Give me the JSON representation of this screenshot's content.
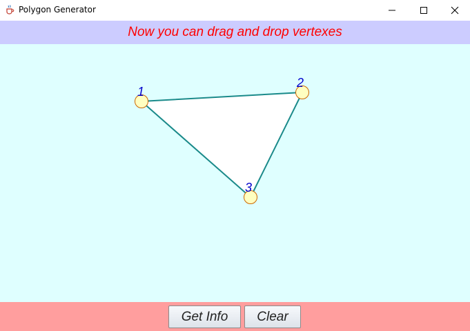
{
  "window": {
    "title": "Polygon Generator",
    "icon": "java-coffee-icon",
    "controls": [
      "minimize-icon",
      "maximize-icon",
      "close-icon"
    ]
  },
  "banner": {
    "message": "Now you can drag and drop vertexes",
    "color": "#ff0000",
    "background": "#ccccff"
  },
  "canvas": {
    "background": "#dfffff",
    "polygon": {
      "fill": "#ffffff",
      "stroke": "#1a8a8a",
      "vertices": [
        {
          "label": "1"
        },
        {
          "label": "2"
        },
        {
          "label": "3"
        }
      ],
      "vertex_fill": "#ffffc0",
      "vertex_stroke": "#cc6600",
      "label_color": "#0000cc"
    }
  },
  "buttons": {
    "get_info": "Get Info",
    "clear": "Clear",
    "bar_background": "#ff9e9e"
  }
}
